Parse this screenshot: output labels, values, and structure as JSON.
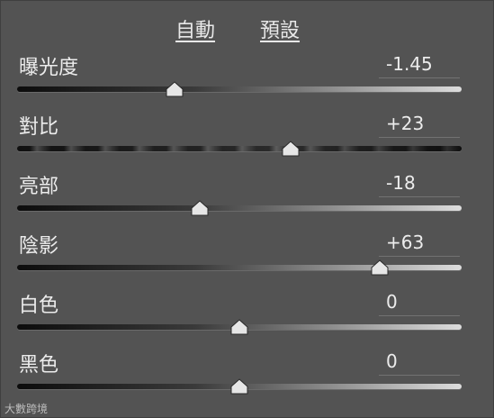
{
  "header": {
    "auto_label": "自動",
    "defaults_label": "預設"
  },
  "sliders": [
    {
      "label": "曝光度",
      "value": "-1.45",
      "level": 0.355
    },
    {
      "label": "對比",
      "value": "+23",
      "level": 0.615
    },
    {
      "label": "亮部",
      "value": "-18",
      "level": 0.41
    },
    {
      "label": "陰影",
      "value": "+63",
      "level": 0.815
    },
    {
      "label": "白色",
      "value": "0",
      "level": 0.5
    },
    {
      "label": "黑色",
      "value": "0",
      "level": 0.5
    }
  ],
  "watermark": "大數跨境",
  "colors": {
    "panel_bg": "#535353",
    "text": "#ececec",
    "thumb": "#e6e6e6"
  }
}
